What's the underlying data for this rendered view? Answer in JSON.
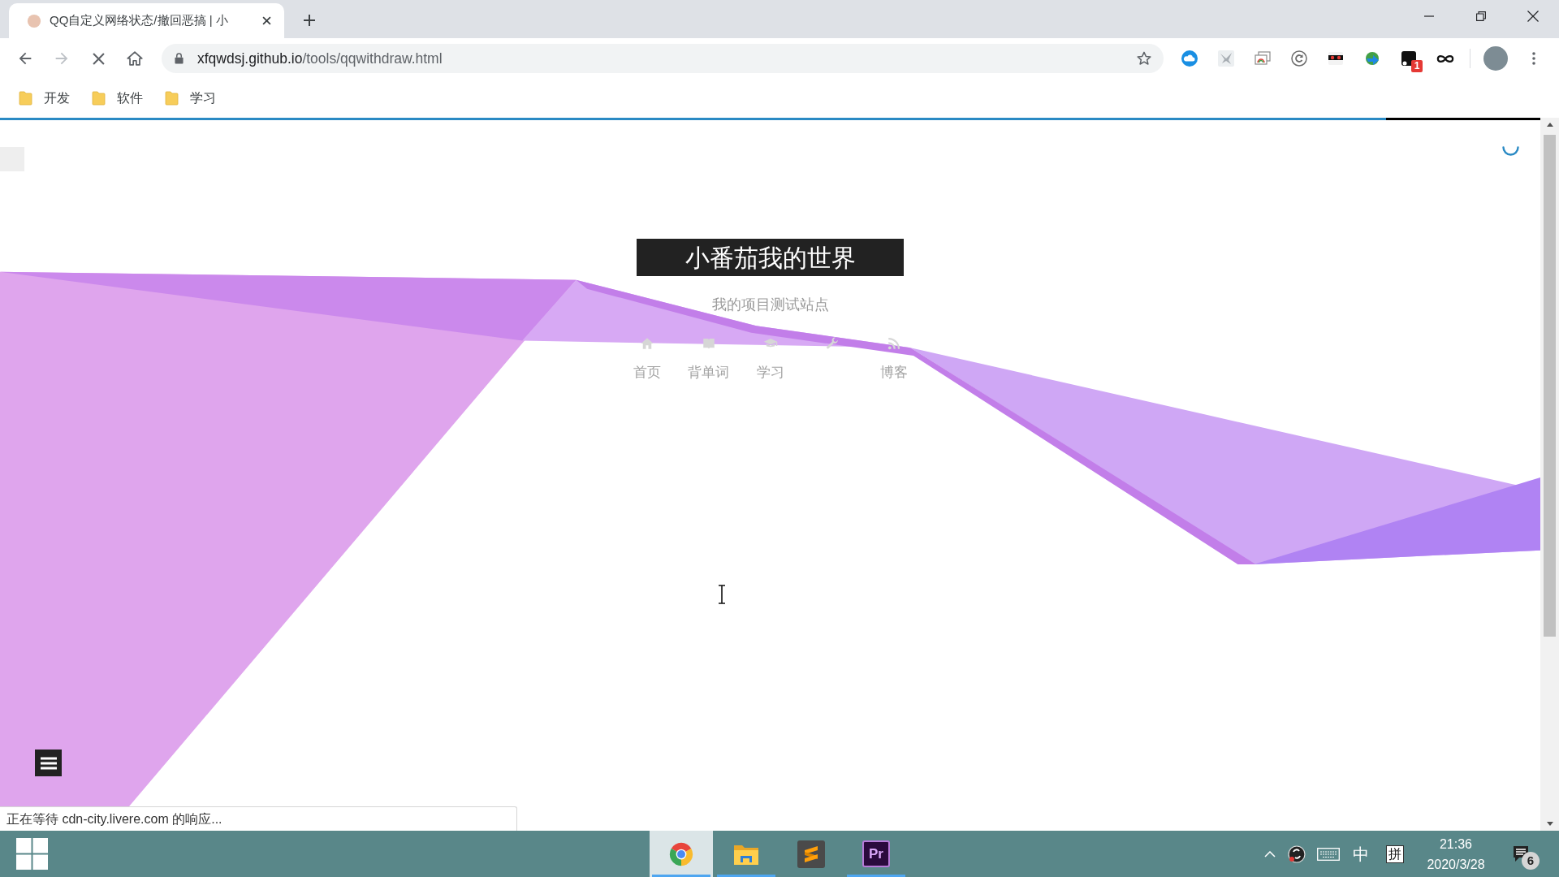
{
  "browser": {
    "tab": {
      "title": "QQ自定义网络状态/撤回恶搞 | 小",
      "selected": true
    },
    "forward_disabled": true,
    "loading": true,
    "url": {
      "host": "xfqwdsj.github.io",
      "path": "/tools/qqwithdraw.html"
    },
    "extension_badge": "1",
    "bookmarks": [
      {
        "label": "开发"
      },
      {
        "label": "软件"
      },
      {
        "label": "学习"
      }
    ],
    "progress": {
      "level": 0.9
    }
  },
  "page": {
    "title": "小番茄我的世界",
    "subtitle": "我的项目测试站点",
    "nav": [
      {
        "kind": "labeled",
        "label": "首页"
      },
      {
        "kind": "labeled",
        "label": "背单词"
      },
      {
        "kind": "labeled",
        "label": "学习"
      },
      {
        "kind": "icon_only"
      },
      {
        "kind": "labeled",
        "label": "博客"
      }
    ],
    "status_text": "正在等待 cdn-city.livere.com 的响应..."
  },
  "taskbar": {
    "apps": [
      {
        "selected": true,
        "running": true
      },
      {
        "selected": false,
        "running": true
      },
      {
        "selected": false,
        "running": false
      },
      {
        "selected": false,
        "running": true,
        "label": "Pr"
      }
    ],
    "tray": {
      "ime_mode": "中",
      "ime": "拼",
      "time": "21:36",
      "date": "2020/3/28",
      "notification_count": "6"
    }
  }
}
